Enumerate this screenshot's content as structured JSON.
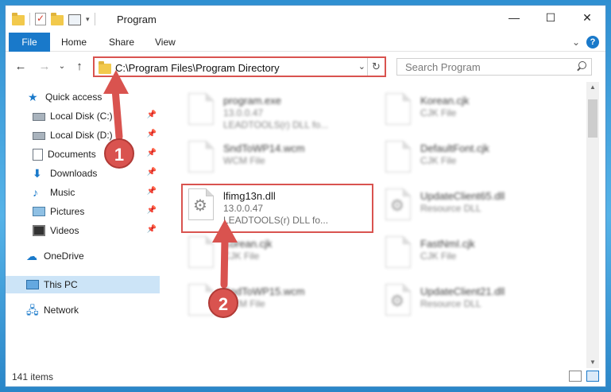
{
  "window": {
    "title": "Program",
    "minimize": "—",
    "maximize": "☐",
    "close": "✕"
  },
  "ribbon": {
    "tabs": [
      "File",
      "Home",
      "Share",
      "View"
    ],
    "expand": "⌄",
    "help": "?"
  },
  "address": {
    "back": "←",
    "forward": "→",
    "recent": "⌄",
    "up": "↑",
    "path": "C:\\Program Files\\Program Directory",
    "dropdown": "⌄",
    "refresh": "↻"
  },
  "search": {
    "placeholder": "Search Program"
  },
  "sidebar": {
    "items": [
      {
        "label": "Quick access",
        "icon": "star-icon",
        "pinned": false
      },
      {
        "label": "Local Disk (C:)",
        "icon": "disk-icon",
        "pinned": true
      },
      {
        "label": "Local Disk (D:)",
        "icon": "disk-icon",
        "pinned": true
      },
      {
        "label": "Documents",
        "icon": "document-icon",
        "pinned": true
      },
      {
        "label": "Downloads",
        "icon": "download-icon",
        "pinned": true
      },
      {
        "label": "Music",
        "icon": "music-icon",
        "pinned": true
      },
      {
        "label": "Pictures",
        "icon": "picture-icon",
        "pinned": true
      },
      {
        "label": "Videos",
        "icon": "video-icon",
        "pinned": true
      },
      {
        "label": "OneDrive",
        "icon": "cloud-icon",
        "pinned": false
      },
      {
        "label": "This PC",
        "icon": "computer-icon",
        "pinned": false,
        "selected": true
      },
      {
        "label": "Network",
        "icon": "network-icon",
        "pinned": false
      }
    ],
    "pin_glyph": "📌"
  },
  "files": [
    {
      "name": "program.exe",
      "line2": "13.0.0.47",
      "line3": "LEADTOOLS(r) DLL fo..."
    },
    {
      "name": "Korean.cjk",
      "line2": "CJK File",
      "line3": ""
    },
    {
      "name": "SndToWP14.wcm",
      "line2": "WCM File",
      "line3": ""
    },
    {
      "name": "DefaultFont.cjk",
      "line2": "CJK File",
      "line3": ""
    },
    {
      "name": "lfimg13n.dll",
      "line2": "13.0.0.47",
      "line3": "LEADTOOLS(r) DLL fo...",
      "highlighted": true
    },
    {
      "name": "UpdateClient65.dll",
      "line2": "Resource DLL",
      "line3": ""
    },
    {
      "name": "Korean.cjk",
      "line2": "CJK File",
      "line3": ""
    },
    {
      "name": "FastNmI.cjk",
      "line2": "CJK File",
      "line3": ""
    },
    {
      "name": "SndToWP15.wcm",
      "line2": "WCM File",
      "line3": ""
    },
    {
      "name": "UpdateClient21.dll",
      "line2": "Resource DLL",
      "line3": ""
    }
  ],
  "status": {
    "items": "141 items"
  },
  "markers": [
    "1",
    "2"
  ],
  "colors": {
    "accent": "#1979ca",
    "annotation": "#d9534f",
    "selected_bg": "#cce4f7"
  }
}
